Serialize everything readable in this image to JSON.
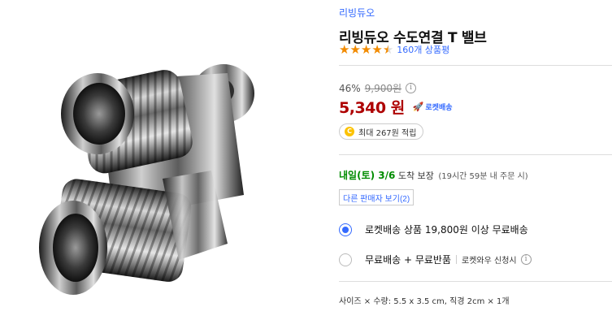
{
  "product": {
    "brand": "리빙듀오",
    "title": "리빙듀오 수도연결 T 밸브",
    "rating": 4.5,
    "review_count": "160개 상품평"
  },
  "price": {
    "discount_percent": "46%",
    "original_price": "9,900원",
    "sale_price": "5,340 원",
    "rocket_label": "로켓배송",
    "cashback": "최대 267원 적립"
  },
  "delivery": {
    "date": "내일(토) 3/6",
    "guarantee": "도착 보장",
    "note": "(19시간 59분 내 주문 시)"
  },
  "other_sellers": "다른 판매자 보기(2)",
  "shipping_options": [
    {
      "label": "로켓배송 상품 19,800원 이상 무료배송",
      "selected": true
    },
    {
      "label": "무료배송 + 무료반품",
      "extra": "로켓와우 신청시",
      "selected": false
    }
  ],
  "specs": "사이즈 × 수량: 5.5 x 3.5 cm, 직경 2cm × 1개",
  "colors": {
    "link": "#346aff",
    "price": "#ae0000",
    "delivery": "#008c00",
    "star": "#f28b00"
  },
  "icons": [
    "star-icon",
    "info-icon",
    "rocket-icon",
    "coin-icon",
    "radio-icon"
  ]
}
